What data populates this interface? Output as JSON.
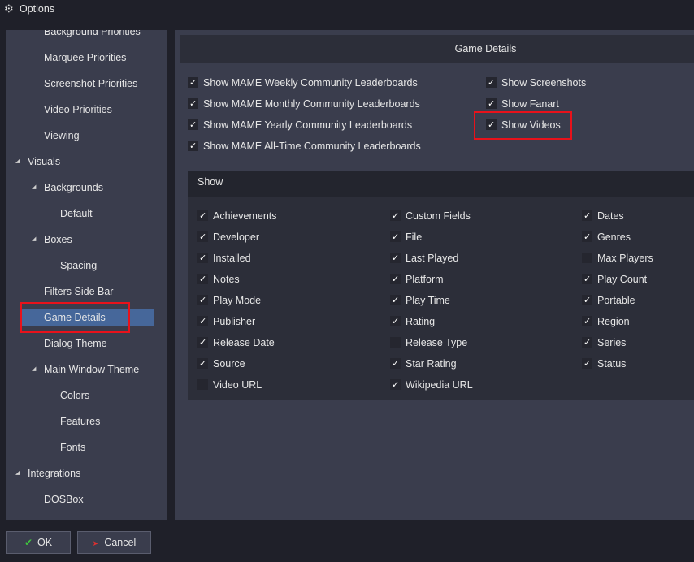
{
  "window": {
    "title": "Options",
    "icon": "gear-icon"
  },
  "sidebar": {
    "items": [
      {
        "label": "Background Priorities",
        "level": 1
      },
      {
        "label": "Marquee Priorities",
        "level": 1
      },
      {
        "label": "Screenshot Priorities",
        "level": 1
      },
      {
        "label": "Video Priorities",
        "level": 1
      },
      {
        "label": "Viewing",
        "level": 1
      },
      {
        "label": "Visuals",
        "level": 0,
        "expanded": true
      },
      {
        "label": "Backgrounds",
        "level": 1,
        "expanded": true
      },
      {
        "label": "Default",
        "level": 2
      },
      {
        "label": "Boxes",
        "level": 1,
        "expanded": true
      },
      {
        "label": "Spacing",
        "level": 2
      },
      {
        "label": "Filters Side Bar",
        "level": 1
      },
      {
        "label": "Game Details",
        "level": 1,
        "selected": true
      },
      {
        "label": "Dialog Theme",
        "level": 1
      },
      {
        "label": "Main Window Theme",
        "level": 1,
        "expanded": true
      },
      {
        "label": "Colors",
        "level": 2
      },
      {
        "label": "Features",
        "level": 2
      },
      {
        "label": "Fonts",
        "level": 2
      },
      {
        "label": "Integrations",
        "level": 0,
        "expanded": true
      },
      {
        "label": "DOSBox",
        "level": 1
      }
    ]
  },
  "panel": {
    "title": "Game Details",
    "options_left": [
      {
        "label": "Show MAME Weekly Community Leaderboards",
        "checked": true
      },
      {
        "label": "Show MAME Monthly Community Leaderboards",
        "checked": true
      },
      {
        "label": "Show MAME Yearly Community Leaderboards",
        "checked": true
      },
      {
        "label": "Show MAME All-Time Community Leaderboards",
        "checked": true
      }
    ],
    "options_right": [
      {
        "label": "Show Screenshots",
        "checked": true
      },
      {
        "label": "Show Fanart",
        "checked": true
      },
      {
        "label": "Show Videos",
        "checked": true
      }
    ],
    "show_title": "Show",
    "show_columns": [
      [
        {
          "label": "Achievements",
          "checked": true
        },
        {
          "label": "Developer",
          "checked": true
        },
        {
          "label": "Installed",
          "checked": true
        },
        {
          "label": "Notes",
          "checked": true
        },
        {
          "label": "Play Mode",
          "checked": true
        },
        {
          "label": "Publisher",
          "checked": true
        },
        {
          "label": "Release Date",
          "checked": true
        },
        {
          "label": "Source",
          "checked": true
        },
        {
          "label": "Video URL",
          "checked": false
        }
      ],
      [
        {
          "label": "Custom Fields",
          "checked": true
        },
        {
          "label": "File",
          "checked": true
        },
        {
          "label": "Last Played",
          "checked": true
        },
        {
          "label": "Platform",
          "checked": true
        },
        {
          "label": "Play Time",
          "checked": true
        },
        {
          "label": "Rating",
          "checked": true
        },
        {
          "label": "Release Type",
          "checked": false
        },
        {
          "label": "Star Rating",
          "checked": true
        },
        {
          "label": "Wikipedia URL",
          "checked": true
        }
      ],
      [
        {
          "label": "Dates",
          "checked": true
        },
        {
          "label": "Genres",
          "checked": true
        },
        {
          "label": "Max Players",
          "checked": false
        },
        {
          "label": "Play Count",
          "checked": true
        },
        {
          "label": "Portable",
          "checked": true
        },
        {
          "label": "Region",
          "checked": true
        },
        {
          "label": "Series",
          "checked": true
        },
        {
          "label": "Status",
          "checked": true
        }
      ]
    ]
  },
  "footer": {
    "ok_label": "OK",
    "cancel_label": "Cancel"
  },
  "colors": {
    "selection": "#46679a",
    "highlight_box": "#e8121b",
    "ok_icon": "#3ec53e",
    "cancel_icon": "#e03030"
  }
}
